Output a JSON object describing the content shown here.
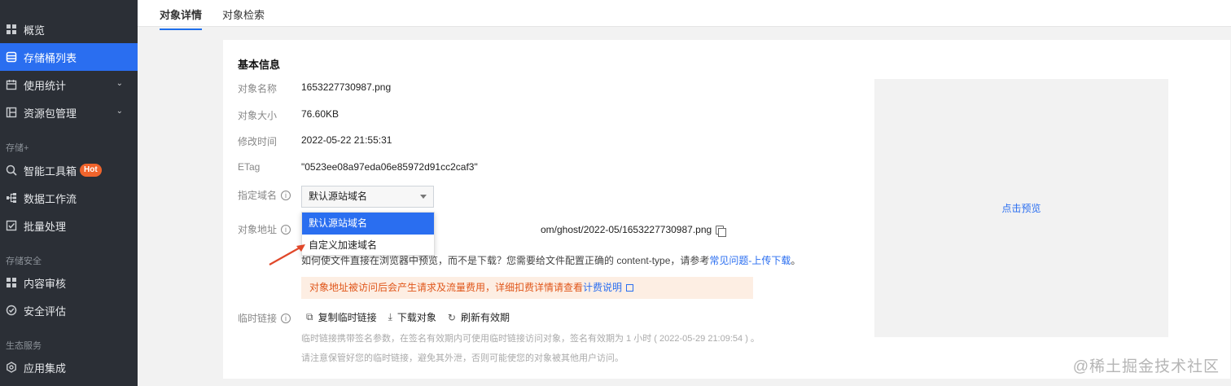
{
  "sidebar": {
    "top_truncated": "",
    "items": [
      {
        "label": "概览",
        "icon": "grid-icon"
      },
      {
        "label": "存储桶列表",
        "icon": "bucket-icon",
        "active": true
      },
      {
        "label": "使用统计",
        "icon": "calendar-icon",
        "chevron": "⌄"
      },
      {
        "label": "资源包管理",
        "icon": "package-icon",
        "chevron": "⌄"
      },
      {
        "label": "智能工具箱",
        "icon": "search-gear-icon",
        "badge": "Hot"
      },
      {
        "label": "数据工作流",
        "icon": "workflow-icon"
      },
      {
        "label": "批量处理",
        "icon": "checkbox-icon"
      },
      {
        "label": "内容审核",
        "icon": "grid-icon"
      },
      {
        "label": "安全评估",
        "icon": "shield-check-icon"
      },
      {
        "label": "应用集成",
        "icon": "gear-icon"
      }
    ],
    "groups": [
      "存储+",
      "存储安全",
      "生态服务"
    ]
  },
  "tabs": [
    {
      "label": "对象详情",
      "active": true
    },
    {
      "label": "对象检索"
    }
  ],
  "card": {
    "title": "基本信息",
    "fields": {
      "name_label": "对象名称",
      "name_value": "1653227730987.png",
      "size_label": "对象大小",
      "size_value": "76.60KB",
      "mtime_label": "修改时间",
      "mtime_value": "2022-05-22 21:55:31",
      "etag_label": "ETag",
      "etag_value": "\"0523ee08a97eda06e85972d91cc2caf3\"",
      "domain_label": "指定域名",
      "url_label": "对象地址",
      "templink_label": "临时链接"
    },
    "domain_select": {
      "value": "默认源站域名",
      "options": [
        "默认源站域名",
        "自定义加速域名"
      ]
    },
    "url_tail": "om/ghost/2022-05/1653227730987.png",
    "tip": {
      "text": "如何使文件直接在浏览器中预览，而不是下载？您需要给文件配置正确的 content-type，请参考",
      "link": "常见问题-上传下载",
      "end": "。"
    },
    "warning": {
      "text": "对象地址被访问后会产生请求及流量费用，详细扣费详情请查看",
      "link": "计费说明"
    },
    "actions": [
      "复制临时链接",
      "下载对象",
      "刷新有效期"
    ],
    "notes": [
      "临时链接携带签名参数，在签名有效期内可使用临时链接访问对象，签名有效期为 1 小时 ( 2022-05-29 21:09:54 ) 。",
      "请注意保管好您的临时链接，避免其外泄，否则可能使您的对象被其他用户访问。"
    ],
    "preview_link": "点击预览"
  },
  "watermark": "@稀土掘金技术社区",
  "colors": {
    "accent": "#2a6ef0",
    "sidebar_bg": "#2b2f36",
    "warn_text": "#e0571b",
    "warn_bg": "#fdeee3",
    "badge": "#f0642c",
    "arrow": "#e0482a"
  }
}
